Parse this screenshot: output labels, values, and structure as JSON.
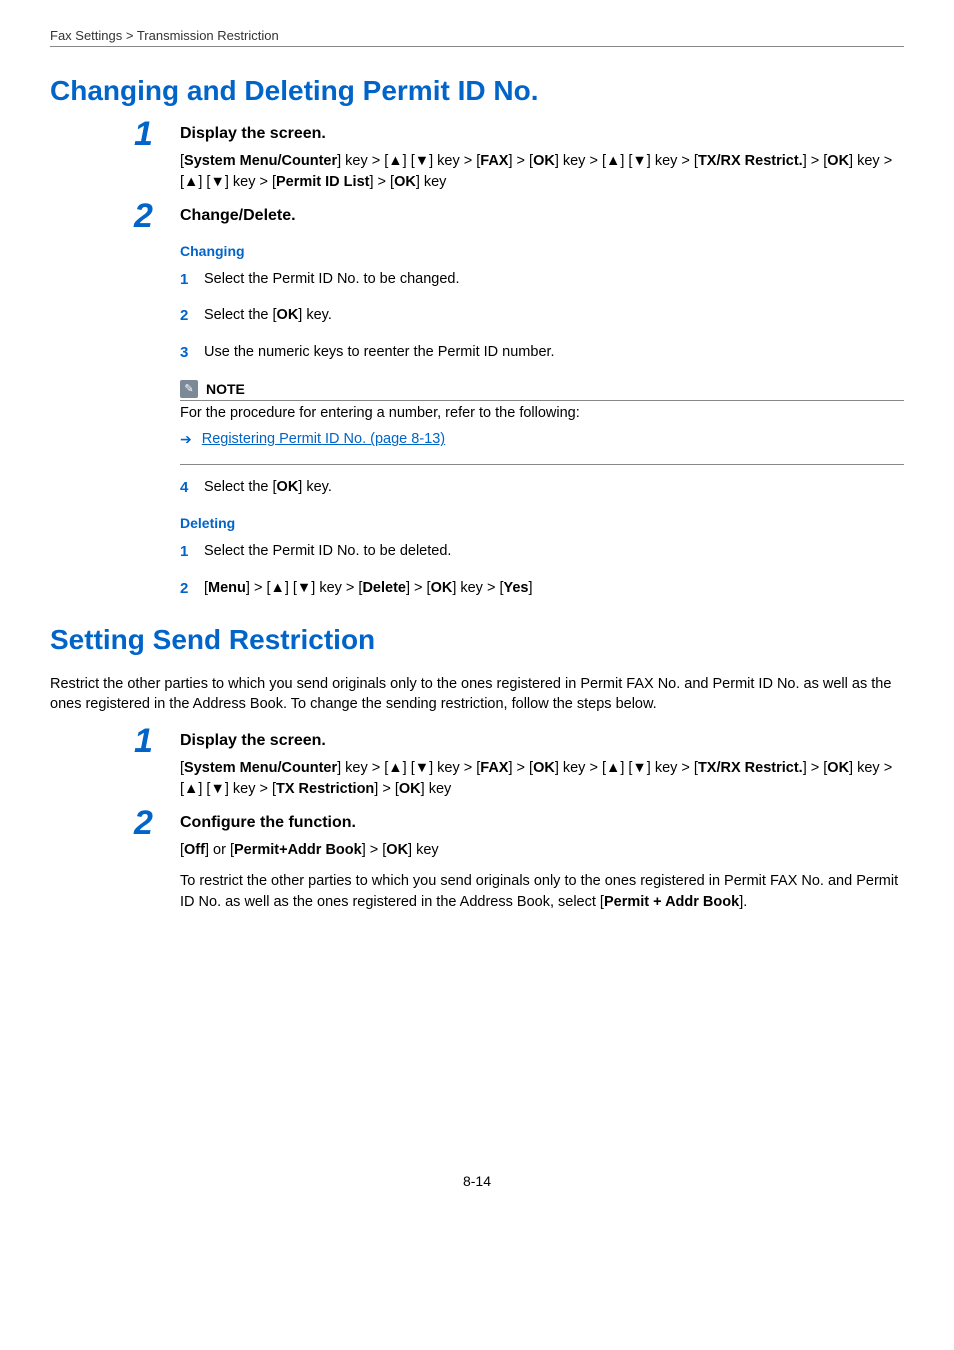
{
  "breadcrumb": "Fax Settings > Transmission Restriction",
  "sec1": {
    "title": "Changing and Deleting Permit ID No.",
    "step1": {
      "num": "1",
      "title": "Display the screen.",
      "p1": {
        "a": "System Menu/Counter",
        "b": "] key > [▲] [▼] key > [",
        "c": "FAX",
        "d": "] > [",
        "e": "OK",
        "f": "] key > [▲] [▼] key > ["
      },
      "p2": {
        "a": "TX/RX Restrict.",
        "b": "] > [",
        "c": "OK",
        "d": "] key > [▲] [▼] key > [",
        "e": "Permit ID List",
        "f": "] > [",
        "g": "OK",
        "h": "] key"
      }
    },
    "step2": {
      "num": "2",
      "title": "Change/Delete.",
      "changing": "Changing",
      "c1": {
        "n": "1",
        "t": "Select the Permit ID No. to be changed."
      },
      "c2": {
        "n": "2",
        "a": "Select the [",
        "b": "OK",
        "c": "] key."
      },
      "c3": {
        "n": "3",
        "t": "Use the numeric keys to reenter the Permit ID number."
      },
      "noteLabel": "NOTE",
      "noteText": "For the procedure for entering a number, refer to the following:",
      "link": "Registering Permit ID No. (page 8-13)",
      "c4": {
        "n": "4",
        "a": "Select the [",
        "b": "OK",
        "c": "] key."
      },
      "deleting": "Deleting",
      "d1": {
        "n": "1",
        "t": "Select the Permit ID No. to be deleted."
      },
      "d2": {
        "n": "2",
        "a": "[",
        "b": "Menu",
        "c": "] > [▲] [▼] key > [",
        "d": "Delete",
        "e": "] > [",
        "f": "OK",
        "g": "] key > [",
        "h": "Yes",
        "i": "]"
      }
    }
  },
  "sec2": {
    "title": "Setting Send Restriction",
    "intro": "Restrict the other parties to which you send originals only to the ones registered in Permit FAX No. and Permit ID No. as well as the ones registered in the Address Book. To change the sending restriction, follow the steps below.",
    "step1": {
      "num": "1",
      "title": "Display the screen.",
      "p1": {
        "a": "System Menu/Counter",
        "b": "] key > [▲] [▼] key > [",
        "c": "FAX",
        "d": "] > [",
        "e": "OK",
        "f": "] key > [▲] [▼] key > ["
      },
      "p2": {
        "a": "TX/RX Restrict.",
        "b": "] > [",
        "c": "OK",
        "d": "] key > [▲] [▼] key > [",
        "e": "TX Restriction",
        "f": "] > [",
        "g": "OK",
        "h": "] key"
      }
    },
    "step2": {
      "num": "2",
      "title": "Configure the function.",
      "a": "[",
      "b": "Off",
      "c": "] or [",
      "d": "Permit+Addr Book",
      "e": "] > [",
      "f": "OK",
      "g": "] key",
      "t1": "To restrict the other parties to which you send originals only to the ones registered in Permit FAX No. and Permit ID No. as well as the ones registered in the Address Book, select [",
      "t2": "Permit + Addr Book",
      "t3": "]."
    }
  },
  "pageNum": "8-14"
}
